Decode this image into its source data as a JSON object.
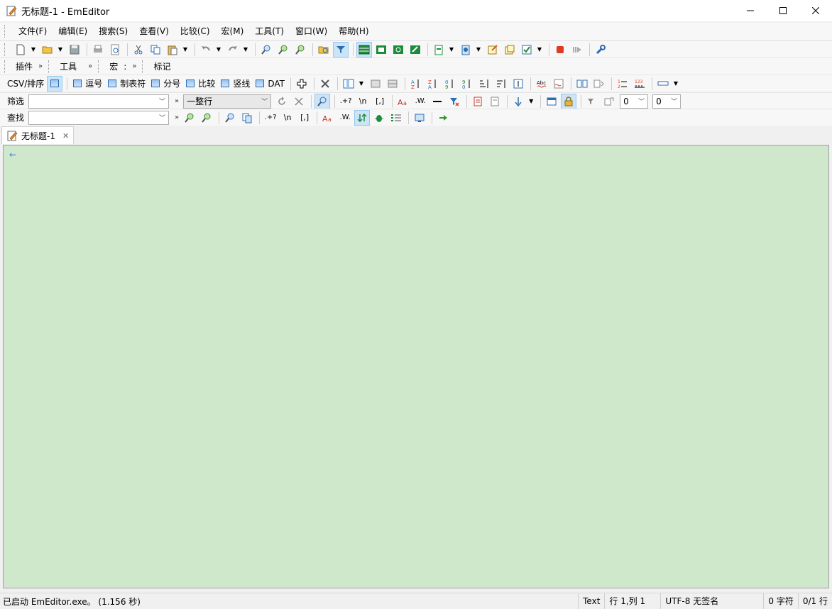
{
  "window": {
    "title": "无标题-1 - EmEditor",
    "minimize_icon": "minimize-icon",
    "maximize_icon": "maximize-icon",
    "close_icon": "close-icon"
  },
  "menu": {
    "items": [
      "文件(F)",
      "编辑(E)",
      "搜索(S)",
      "查看(V)",
      "比较(C)",
      "宏(M)",
      "工具(T)",
      "窗口(W)",
      "帮助(H)"
    ]
  },
  "bars": {
    "plugins_label": "插件",
    "tools_label": "工具",
    "macro_label": "宏",
    "macro_suffix": ":",
    "marks_label": "标记"
  },
  "csv": {
    "label": "CSV/排序",
    "modes": [
      "逗号",
      "制表符",
      "分号",
      "比较",
      "竖线",
      "DAT"
    ]
  },
  "filter": {
    "label": "筛选",
    "value": "",
    "scope": "一整行",
    "spin1": "0",
    "spin2": "0"
  },
  "find": {
    "label": "查找",
    "value": ""
  },
  "tabs": [
    {
      "title": "无标题-1"
    }
  ],
  "editor": {
    "eol_marker": "←"
  },
  "status": {
    "message": "已启动 EmEditor.exe。 (1.156 秒)",
    "mode": "Text",
    "position": "行 1,列 1",
    "encoding": "UTF-8 无签名",
    "chars": "0 字符",
    "lines": "0/1 行"
  },
  "colors": {
    "editor_bg": "#cfe8cc",
    "accent": "#2b6db5",
    "active_btn": "#cce4f7"
  }
}
